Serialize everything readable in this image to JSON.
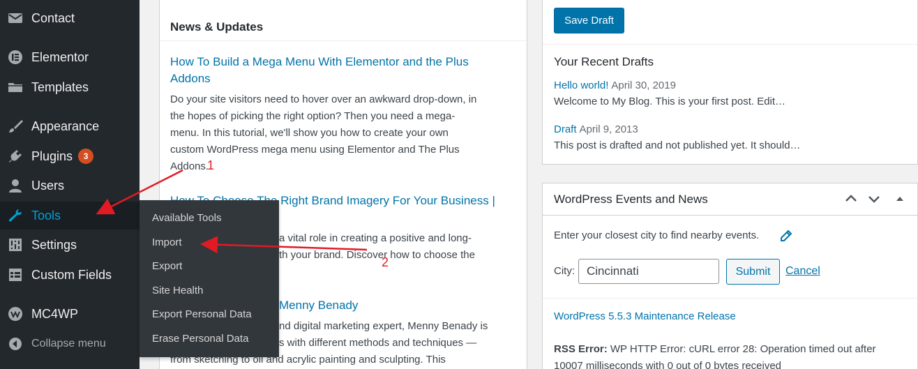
{
  "sidebar": {
    "items": [
      {
        "label": "Contact",
        "icon": "envelope-icon"
      },
      {
        "label": "Elementor",
        "icon": "elementor-icon"
      },
      {
        "label": "Templates",
        "icon": "folder-icon"
      },
      {
        "label": "Appearance",
        "icon": "paintbrush-icon"
      },
      {
        "label": "Plugins",
        "icon": "plug-icon",
        "badge": "3"
      },
      {
        "label": "Users",
        "icon": "user-icon"
      },
      {
        "label": "Tools",
        "icon": "wrench-icon",
        "active": true
      },
      {
        "label": "Settings",
        "icon": "settings-icon"
      },
      {
        "label": "Custom Fields",
        "icon": "grid-icon"
      },
      {
        "label": "MC4WP",
        "icon": "mc4wp-icon"
      },
      {
        "label": "Collapse menu",
        "icon": "collapse-icon"
      }
    ],
    "accent_color": "#00a0d2",
    "badge_color": "#d54e21"
  },
  "tools_submenu": [
    "Available Tools",
    "Import",
    "Export",
    "Site Health",
    "Export Personal Data",
    "Erase Personal Data"
  ],
  "news": {
    "heading": "News & Updates",
    "articles": [
      {
        "title_line1": "How To Build a Mega Menu With Elementor and the Plus",
        "title_line2": "Addons",
        "excerpt_lines": [
          "Do your site visitors need to hover over an awkward drop-down, in",
          "the hopes of picking the right option? Then you need a mega-",
          "menu. In this tutorial, we'll show you how to create your own",
          "custom WordPress mega menu using Elementor and The Plus",
          "Addons."
        ]
      },
      {
        "title_line1": "How To Choose The Right Brand Imagery For Your Business |",
        "excerpt_lines": [
          "a vital role in creating a positive and long-",
          "th your brand. Discover how to choose the"
        ]
      },
      {
        "title_line1": "Menny Benady",
        "excerpt_lines": [
          "nd digital marketing expert, Menny Benady is",
          "s with different methods and techniques —",
          "from sketching to oil and acrylic painting and sculpting. This"
        ]
      }
    ]
  },
  "drafts": {
    "save_label": "Save Draft",
    "title": "Your Recent Drafts",
    "items": [
      {
        "link": "Hello world!",
        "date": "April 30, 2019",
        "excerpt": "Welcome to My Blog. This is your first post. Edit…"
      },
      {
        "link": "Draft",
        "date": "April 9, 2013",
        "excerpt": "This post is drafted and not published yet. It should…"
      }
    ]
  },
  "events": {
    "title": "WordPress Events and News",
    "prompt": "Enter your closest city to find nearby events.",
    "city_label": "City:",
    "city_value": "Cincinnati",
    "submit_label": "Submit",
    "cancel_label": "Cancel",
    "release_link": "WordPress 5.5.3 Maintenance Release",
    "rss_error_label": "RSS Error:",
    "rss_error_line1": "WP HTTP Error: cURL error 28: Operation timed out after",
    "rss_error_line2": "10007 milliseconds with 0 out of 0 bytes received"
  },
  "annotations": {
    "arrow1": "1",
    "arrow2": "2",
    "color": "#e01b24"
  }
}
